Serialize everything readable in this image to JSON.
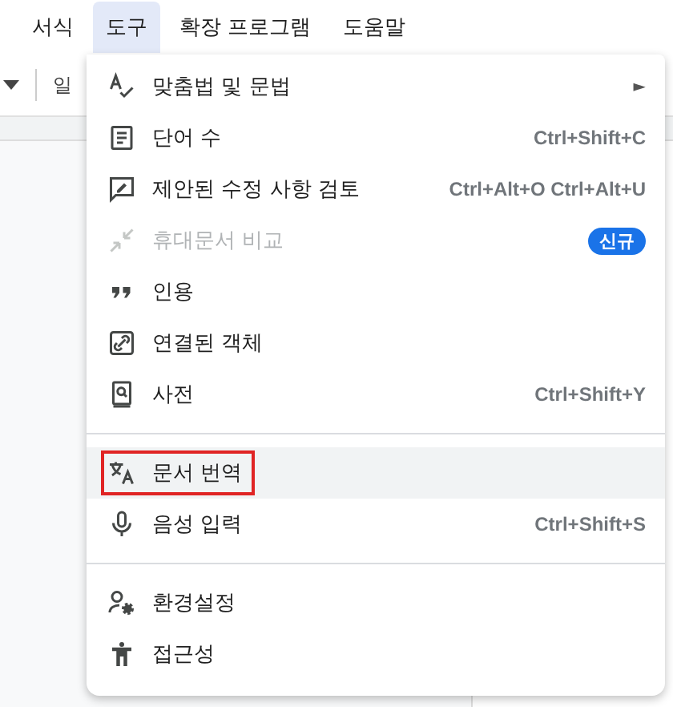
{
  "menubar": [
    {
      "label": "서식",
      "selected": false
    },
    {
      "label": "도구",
      "selected": true
    },
    {
      "label": "확장 프로그램",
      "selected": false
    },
    {
      "label": "도움말",
      "selected": false
    }
  ],
  "toolbar": {
    "style_label": "일"
  },
  "menu": {
    "groups": [
      [
        {
          "label": "맞춤법 및 문법",
          "submenu": "►",
          "disabled": false,
          "selected": false,
          "marked": false
        },
        {
          "label": "단어 수",
          "shortcut": "Ctrl+Shift+C",
          "disabled": false,
          "selected": false,
          "marked": false
        },
        {
          "label": "제안된 수정 사항 검토",
          "shortcut": "Ctrl+Alt+O Ctrl+Alt+U",
          "disabled": false,
          "selected": false,
          "marked": false
        },
        {
          "label": "휴대문서 비교",
          "badge": "신규",
          "disabled": true,
          "selected": false,
          "marked": false
        },
        {
          "label": "인용",
          "disabled": false,
          "selected": false,
          "marked": false
        },
        {
          "label": "연결된 객체",
          "disabled": false,
          "selected": false,
          "marked": false
        },
        {
          "label": "사전",
          "shortcut": "Ctrl+Shift+Y",
          "disabled": false,
          "selected": false,
          "marked": false
        }
      ],
      [
        {
          "label": "문서 번역",
          "disabled": false,
          "selected": true,
          "marked": true
        },
        {
          "label": "음성 입력",
          "shortcut": "Ctrl+Shift+S",
          "disabled": false,
          "selected": false,
          "marked": false
        }
      ],
      [
        {
          "label": "환경설정",
          "disabled": false,
          "selected": false,
          "marked": false
        },
        {
          "label": "접근성",
          "disabled": false,
          "selected": false,
          "marked": false
        }
      ]
    ]
  }
}
